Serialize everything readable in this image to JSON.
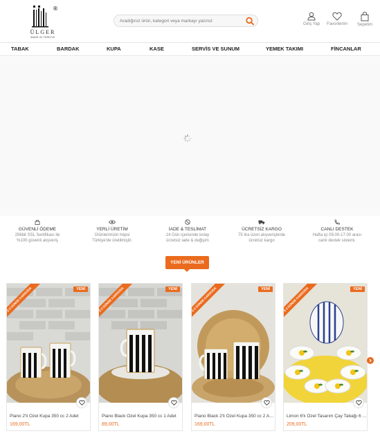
{
  "brand": {
    "name": "ÜLGER",
    "tagline": "MADE IN TÜRKİYE",
    "registered": "®"
  },
  "search": {
    "placeholder": "Aradığınız ürün, kategori veya markayı yazınız"
  },
  "header_icons": {
    "login": "Giriş Yap",
    "favorites": "Favorilerim",
    "cart": "Sepetim"
  },
  "nav": {
    "items": [
      "TABAK",
      "BARDAK",
      "KUPA",
      "KASE",
      "SERVİS VE SUNUM",
      "YEMEK TAKIMI",
      "FİNCANLAR"
    ]
  },
  "features": [
    {
      "icon": "shield-lock-icon",
      "title": "GÜVENLİ ÖDEME",
      "desc1": "256bit SSL Sertifikası ile",
      "desc2": "%100 güvenli alışveriş"
    },
    {
      "icon": "eye-icon",
      "title": "YERLİ ÜRETİM",
      "desc1": "Ürünlerimizin hepsi",
      "desc2": "Türkiye'de üretilmiştir."
    },
    {
      "icon": "return-icon",
      "title": "İADE & TESLİMAT",
      "desc1": "14 Gün içerisinde kolay",
      "desc2": "ücretsiz iade & değişim"
    },
    {
      "icon": "truck-icon",
      "title": "ÜCRETSİZ KARGO",
      "desc1": "75 lira üzeri alışverişlerde",
      "desc2": "ücretsiz kargo"
    },
    {
      "icon": "phone-icon",
      "title": "CANLI DESTEK",
      "desc1": "Hafta içi 09.00-17.00 arası",
      "desc2": "canlı destek sistemi."
    }
  ],
  "section": {
    "new_products": "YENİ ÜRÜNLER"
  },
  "products": [
    {
      "name": "Piano 2'li Özel Kupa 350 cc 2 Adet",
      "price": "169,00TL",
      "badge": "YENİ",
      "ribbon": "2-3 GÜNDE KARGODA"
    },
    {
      "name": "Piano Black Özel Kupa 350 cc 1 Adet",
      "price": "89,00TL",
      "badge": "YENİ",
      "ribbon": "2-3 GÜNDE KARGODA"
    },
    {
      "name": "Piano Black 2'li Özel Kupa 350 cc 2 Adet",
      "price": "169,00TL",
      "badge": "YENİ",
      "ribbon": "2-3 GÜNDE KARGODA"
    },
    {
      "name": "Limon 6'lı Özel Tasarım Çay Tabağı 6 Adet",
      "price": "209,00TL",
      "badge": "YENİ",
      "ribbon": "2-3 GÜNDE KARGODA"
    }
  ],
  "colors": {
    "accent": "#ea6b1e"
  }
}
